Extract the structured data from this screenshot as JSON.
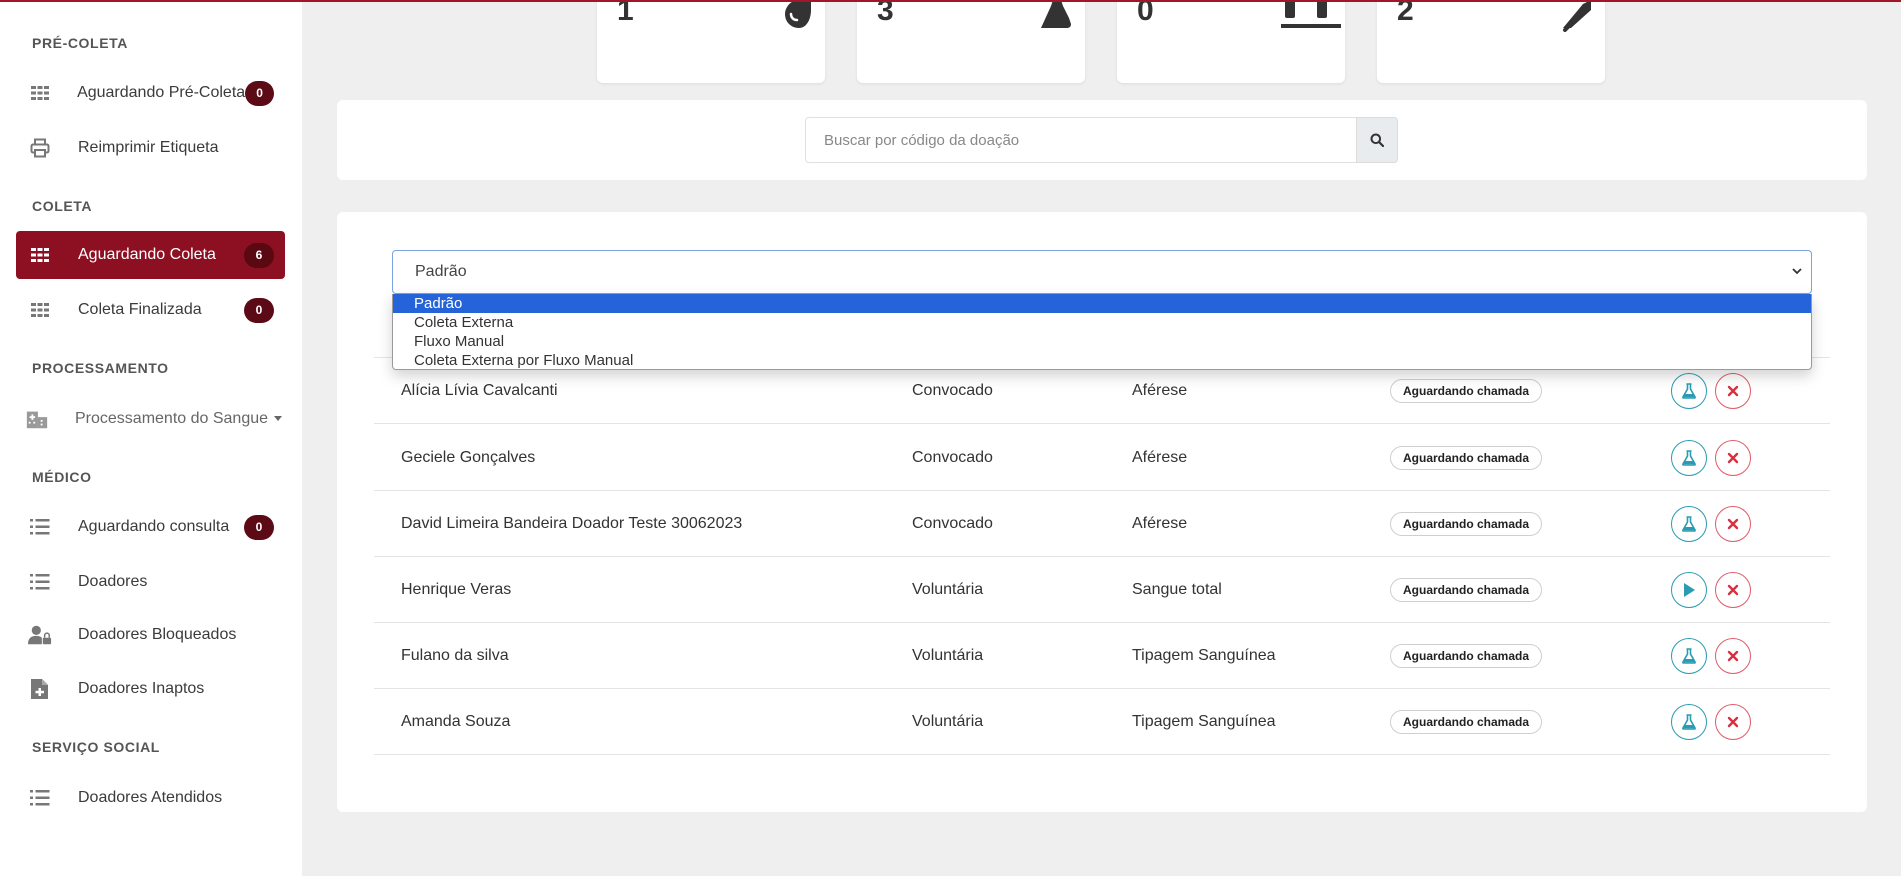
{
  "sidebar": {
    "sections": [
      {
        "title": "PRÉ-COLETA"
      },
      {
        "title": "COLETA"
      },
      {
        "title": "PROCESSAMENTO"
      },
      {
        "title": "MÉDICO"
      },
      {
        "title": "SERVIÇO SOCIAL"
      }
    ],
    "items": [
      {
        "label": "Aguardando Pré-Coleta",
        "badge": "0",
        "icon": "grid-icon"
      },
      {
        "label": "Reimprimir Etiqueta",
        "icon": "printer-icon"
      },
      {
        "label": "Aguardando Coleta",
        "badge": "6",
        "icon": "grid-icon",
        "active": true
      },
      {
        "label": "Coleta Finalizada",
        "badge": "0",
        "icon": "grid-icon"
      },
      {
        "label": "Processamento do Sangue",
        "icon": "hospital-icon"
      },
      {
        "label": "Aguardando consulta",
        "badge": "0",
        "icon": "list-icon"
      },
      {
        "label": "Doadores",
        "icon": "list-icon"
      },
      {
        "label": "Doadores Bloqueados",
        "icon": "user-lock-icon"
      },
      {
        "label": "Doadores Inaptos",
        "icon": "file-medical-icon"
      },
      {
        "label": "Doadores Atendidos",
        "icon": "list-icon"
      }
    ]
  },
  "stats": [
    {
      "value": "1",
      "icon": "tint-icon"
    },
    {
      "value": "3",
      "icon": "flask-icon"
    },
    {
      "value": "0",
      "icon": "bed-icon"
    },
    {
      "value": "2",
      "icon": "syringe-icon"
    }
  ],
  "search": {
    "placeholder": "Buscar por código da doação",
    "value": ""
  },
  "filter": {
    "selected": "Padrão",
    "options": [
      "Padrão",
      "Coleta Externa",
      "Fluxo Manual",
      "Coleta Externa por Fluxo Manual"
    ]
  },
  "table": {
    "rows": [
      {
        "name": "Alícia Lívia Cavalcanti",
        "type": "Convocado",
        "procedure": "Aférese",
        "status": "Aguardando chamada",
        "action": "flask-icon"
      },
      {
        "name": "Geciele Gonçalves",
        "type": "Convocado",
        "procedure": "Aférese",
        "status": "Aguardando chamada",
        "action": "flask-icon"
      },
      {
        "name": "David Limeira Bandeira Doador Teste 30062023",
        "type": "Convocado",
        "procedure": "Aférese",
        "status": "Aguardando chamada",
        "action": "flask-icon"
      },
      {
        "name": "Henrique Veras",
        "type": "Voluntária",
        "procedure": "Sangue total",
        "status": "Aguardando chamada",
        "action": "play-icon"
      },
      {
        "name": "Fulano da silva",
        "type": "Voluntária",
        "procedure": "Tipagem Sanguínea",
        "status": "Aguardando chamada",
        "action": "flask-icon"
      },
      {
        "name": "Amanda Souza",
        "type": "Voluntária",
        "procedure": "Tipagem Sanguínea",
        "status": "Aguardando chamada",
        "action": "flask-icon"
      }
    ]
  },
  "colors": {
    "accent": "#8c0f22",
    "badge": "#5c0a16",
    "teal": "#2a9bb3",
    "danger": "#e05a6a",
    "dropdown_selected": "#2563d8"
  }
}
